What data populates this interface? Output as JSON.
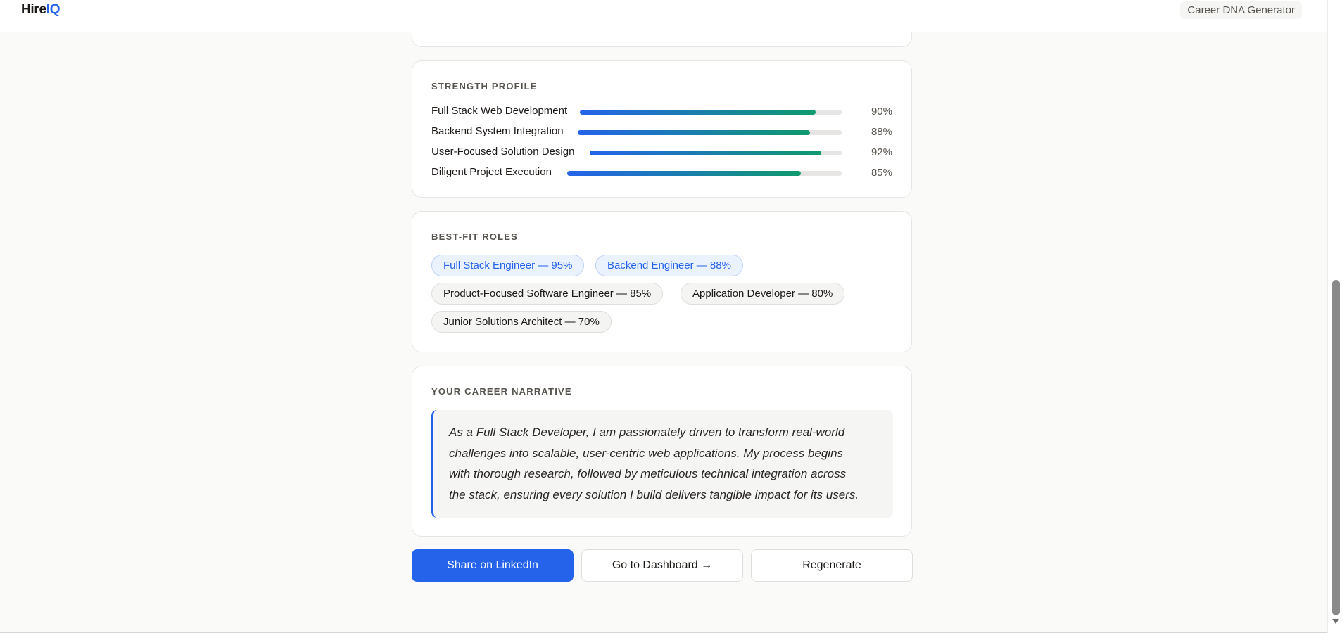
{
  "header": {
    "brand_prefix": "Hire",
    "brand_accent": "IQ",
    "page_label": "Career DNA Generator"
  },
  "strength_profile": {
    "title": "STRENGTH PROFILE",
    "items": [
      {
        "label": "Full Stack Web Development",
        "percent": 90,
        "percent_text": "90%"
      },
      {
        "label": "Backend System Integration",
        "percent": 88,
        "percent_text": "88%"
      },
      {
        "label": "User-Focused Solution Design",
        "percent": 92,
        "percent_text": "92%"
      },
      {
        "label": "Diligent Project Execution",
        "percent": 85,
        "percent_text": "85%"
      }
    ]
  },
  "best_fit_roles": {
    "title": "BEST-FIT ROLES",
    "roles": [
      {
        "label": "Full Stack Engineer — 95%",
        "highlighted": true
      },
      {
        "label": "Backend Engineer — 88%",
        "highlighted": true
      },
      {
        "label": "Product-Focused Software Engineer — 85%",
        "highlighted": false
      },
      {
        "label": "Application Developer — 80%",
        "highlighted": false
      },
      {
        "label": "Junior Solutions Architect — 70%",
        "highlighted": false
      }
    ]
  },
  "narrative": {
    "title": "YOUR CAREER NARRATIVE",
    "lines": [
      "As a Full Stack Developer, I am passionately driven to transform real-world",
      "challenges into scalable, user-centric web applications. My process begins",
      "with thorough research, followed by meticulous technical integration across",
      "the stack, ensuring every solution I build delivers tangible impact for its users."
    ]
  },
  "actions": {
    "share": "Share on LinkedIn",
    "dashboard": "Go to Dashboard →",
    "regenerate": "Regenerate"
  },
  "colors": {
    "accent": "#2563eb",
    "bar_gradient_end": "#0f9a6e",
    "page_background": "#fafaf9"
  }
}
